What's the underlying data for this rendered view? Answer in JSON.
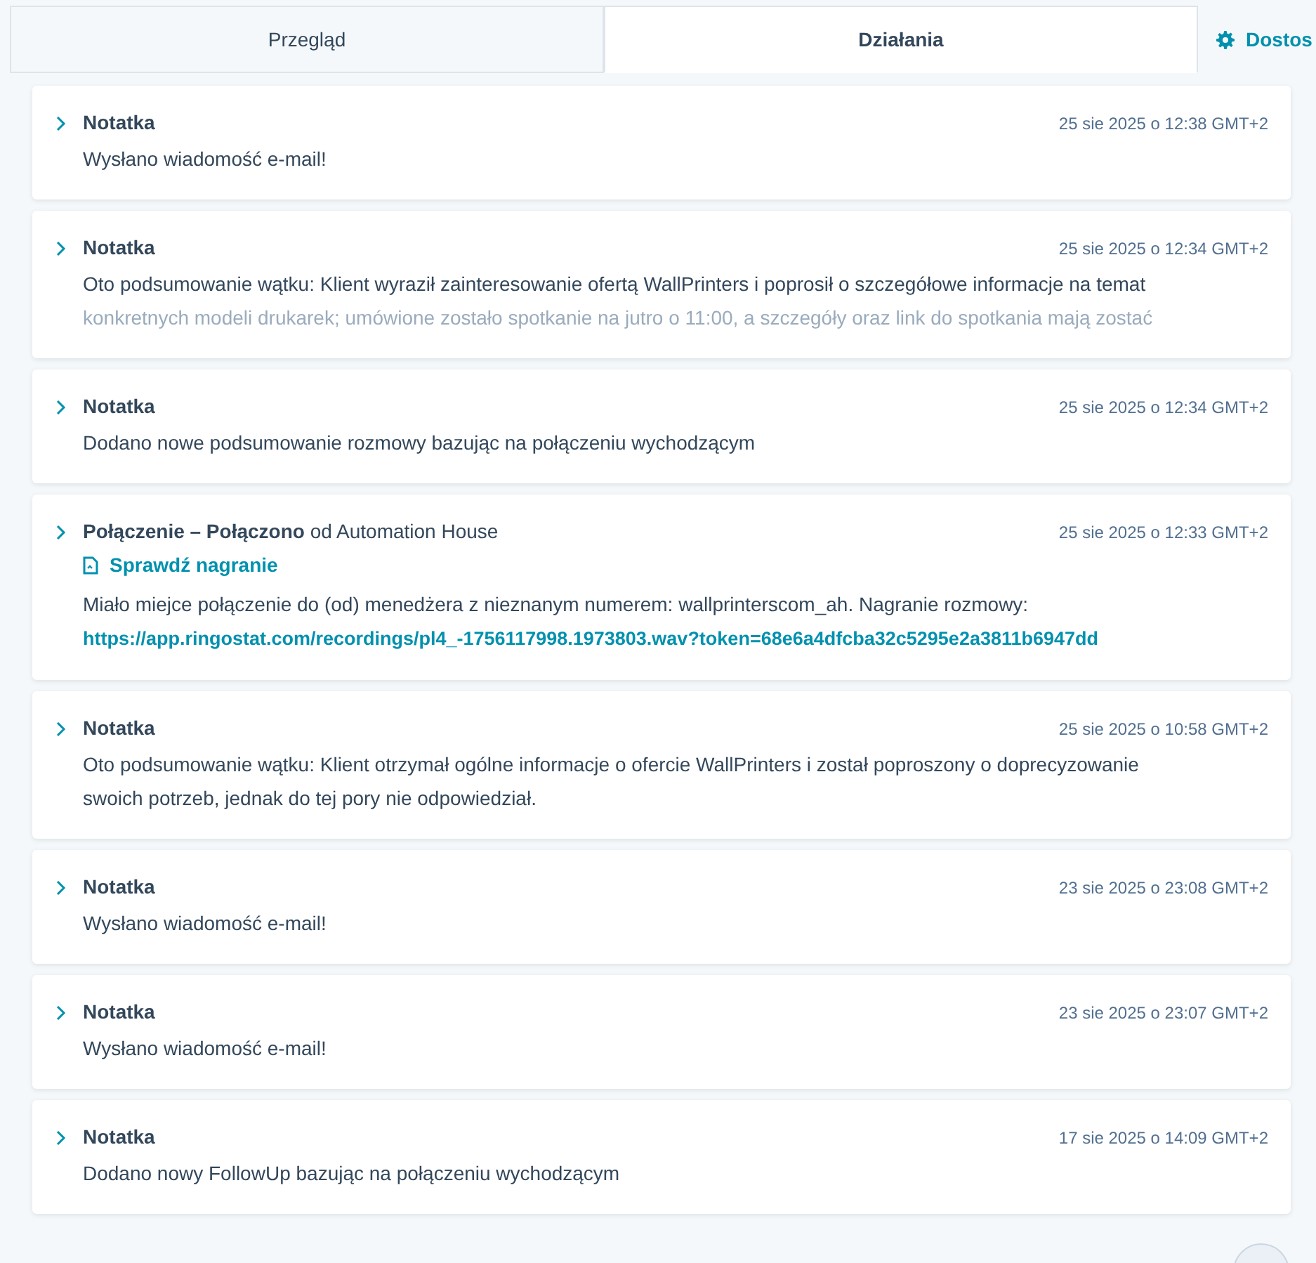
{
  "tabs": [
    {
      "kind": "tab",
      "label": "Przegląd",
      "selected": false
    },
    {
      "kind": "tab",
      "label": "Działania",
      "selected": true
    },
    {
      "kind": "action",
      "label": "Dostos",
      "selected": false
    }
  ],
  "activities": [
    {
      "kind": "note",
      "title": "Notatka",
      "date": "25 sie 2025 o 12:38 GMT+2",
      "expanded": false,
      "lines": [
        "Wysłano wiadomość e-mail!"
      ]
    },
    {
      "kind": "note",
      "title": "Notatka",
      "date": "25 sie 2025 o 12:34 GMT+2",
      "expanded": false,
      "truncated": true,
      "lines": [
        "Oto podsumowanie wątku: Klient wyraził zainteresowanie ofertą WallPrinters i poprosił o szczegółowe informacje na temat",
        "konkretnych modeli drukarek; umówione zostało spotkanie na jutro o 11:00, a szczegóły oraz link do spotkania mają zostać"
      ]
    },
    {
      "kind": "note",
      "title": "Notatka",
      "date": "25 sie 2025 o 12:34 GMT+2",
      "expanded": false,
      "lines": [
        "Dodano nowe podsumowanie rozmowy bazując na połączeniu wychodzącym"
      ]
    },
    {
      "kind": "call",
      "title": "**Połączenie – Połączono** od Automation House",
      "date": "25 sie 2025 o 12:33 GMT+2",
      "expanded": false,
      "recording_link": "Sprawdź nagranie",
      "lines": [
        "Miało miejce połączenie do (od) menedżera z nieznanym numerem: wallprinterscom_ah. Nagranie rozmowy:"
      ],
      "url": "https://app.ringostat.com/recordings/pl4_-1756117998.1973803.wav?token=68e6a4dfcba32c5295e2a3811b6947dd"
    },
    {
      "kind": "note",
      "title": "Notatka",
      "date": "25 sie 2025 o 10:58 GMT+2",
      "expanded": false,
      "lines": [
        "Oto podsumowanie wątku: Klient otrzymał ogólne informacje o ofercie WallPrinters i został poproszony o doprecyzowanie",
        "swoich potrzeb, jednak do tej pory nie odpowiedział."
      ]
    },
    {
      "kind": "note",
      "title": "Notatka",
      "date": "23 sie 2025 o 23:08 GMT+2",
      "expanded": false,
      "lines": [
        "Wysłano wiadomość e-mail!"
      ]
    },
    {
      "kind": "note",
      "title": "Notatka",
      "date": "23 sie 2025 o 23:07 GMT+2",
      "expanded": false,
      "lines": [
        "Wysłano wiadomość e-mail!"
      ]
    },
    {
      "kind": "note",
      "title": "Notatka",
      "date": "17 sie 2025 o 14:09 GMT+2",
      "expanded": false,
      "lines": [
        "Dodano nowy FollowUp bazując na połączeniu wychodzącym"
      ]
    }
  ]
}
